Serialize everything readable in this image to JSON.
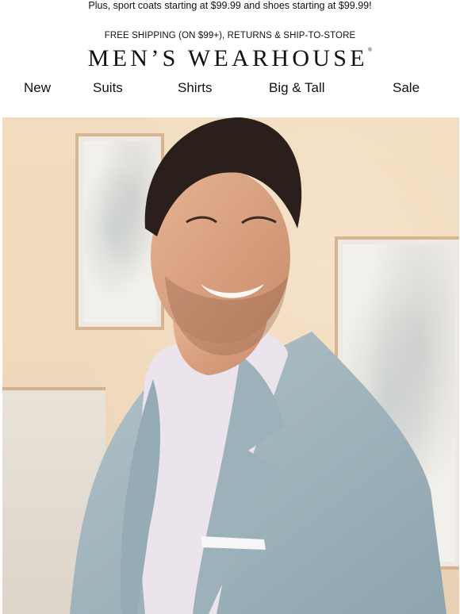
{
  "header": {
    "promo_text": "Plus, sport coats starting at $99.99 and shoes starting at $99.99!",
    "shipping_text": "FREE SHIPPING (ON $99+), RETURNS & SHIP-TO-STORE",
    "brand": "MEN’S WEARHOUSE",
    "brand_mark": "®"
  },
  "nav": {
    "items": [
      {
        "label": "New"
      },
      {
        "label": "Suits"
      },
      {
        "label": "Shirts"
      },
      {
        "label": "Big & Tall"
      },
      {
        "label": "Sale"
      }
    ]
  },
  "hero": {
    "image_icon": "hero-photo-man-in-light-blue-sport-coat"
  },
  "colors": {
    "wall": "#efd8bb",
    "jacket": "#9fb3bd",
    "shirt": "#ece6ee",
    "text": "#111111"
  }
}
